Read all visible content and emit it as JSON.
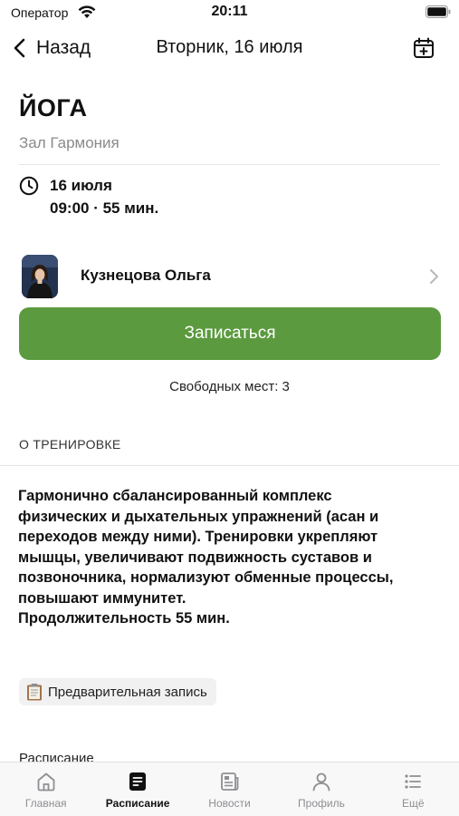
{
  "status_bar": {
    "carrier": "Оператор",
    "time": "20:11"
  },
  "nav": {
    "back_label": "Назад",
    "title": "Вторник, 16 июля"
  },
  "workout": {
    "title": "ЙОГА",
    "hall": "Зал Гармония",
    "date": "16 июля",
    "time_duration": "09:00 · 55 мин."
  },
  "trainer": {
    "name": "Кузнецова Ольга"
  },
  "signup": {
    "button_label": "Записаться",
    "free_slots": "Свободных мест: 3"
  },
  "about": {
    "header": "О ТРЕНИРОВКЕ",
    "lines": [
      "Гармонично сбалансированный комплекс",
      "физических и дыхательных упражнений (асан и",
      "переходов между ними). Тренировки укрепляют",
      "мышцы, увеличивают подвижность суставов и",
      "позвоночника, нормализуют обменные процессы,",
      "повышают иммунитет.",
      "Продолжительность 55 мин."
    ]
  },
  "tag": {
    "label": "Предварительная запись",
    "icon": "clipboard-icon"
  },
  "schedule": {
    "label": "Расписание"
  },
  "tabs": [
    {
      "label": "Главная",
      "icon": "home-icon"
    },
    {
      "label": "Расписание",
      "icon": "schedule-icon",
      "active": true
    },
    {
      "label": "Новости",
      "icon": "news-icon"
    },
    {
      "label": "Профиль",
      "icon": "profile-icon"
    },
    {
      "label": "Ещё",
      "icon": "more-icon"
    }
  ],
  "colors": {
    "accent_green": "#5b9a3e",
    "tab_inactive": "#8e8e93"
  }
}
